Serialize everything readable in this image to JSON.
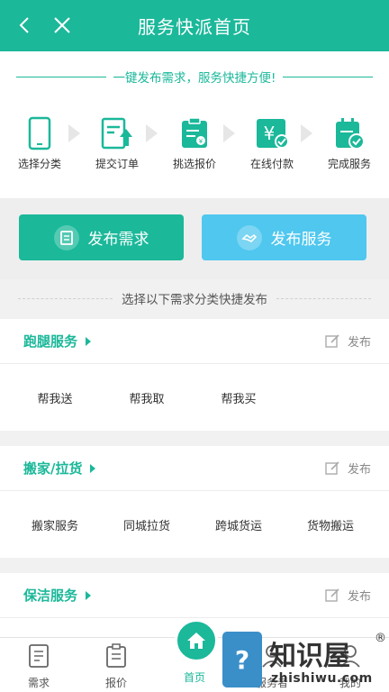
{
  "header": {
    "title": "服务快派首页"
  },
  "slogan": "一键发布需求，服务快捷方便!",
  "steps": [
    {
      "label": "选择分类",
      "icon": "phone-icon"
    },
    {
      "label": "提交订单",
      "icon": "submit-order-icon"
    },
    {
      "label": "挑选报价",
      "icon": "quote-icon"
    },
    {
      "label": "在线付款",
      "icon": "payment-icon"
    },
    {
      "label": "完成服务",
      "icon": "complete-icon"
    }
  ],
  "actions": {
    "publish_need": "发布需求",
    "publish_service": "发布服务"
  },
  "hint": "选择以下需求分类快捷发布",
  "publish_label": "发布",
  "categories": [
    {
      "name": "跑腿服务",
      "items": [
        "帮我送",
        "帮我取",
        "帮我买"
      ]
    },
    {
      "name": "搬家/拉货",
      "items": [
        "搬家服务",
        "同城拉货",
        "跨城货运",
        "货物搬运"
      ]
    },
    {
      "name": "保洁服务",
      "items": []
    }
  ],
  "tabs": [
    {
      "label": "需求",
      "icon": "document-icon"
    },
    {
      "label": "报价",
      "icon": "clipboard-icon"
    },
    {
      "label": "首页",
      "icon": "home-icon"
    },
    {
      "label": "服务者",
      "icon": "worker-icon"
    },
    {
      "label": "我的",
      "icon": "user-icon"
    }
  ],
  "watermark": {
    "brand": "知识屋",
    "domain": "zhishiwu.com",
    "reg": "®"
  },
  "colors": {
    "primary": "#1bb89a",
    "secondary": "#4fc7ef"
  }
}
